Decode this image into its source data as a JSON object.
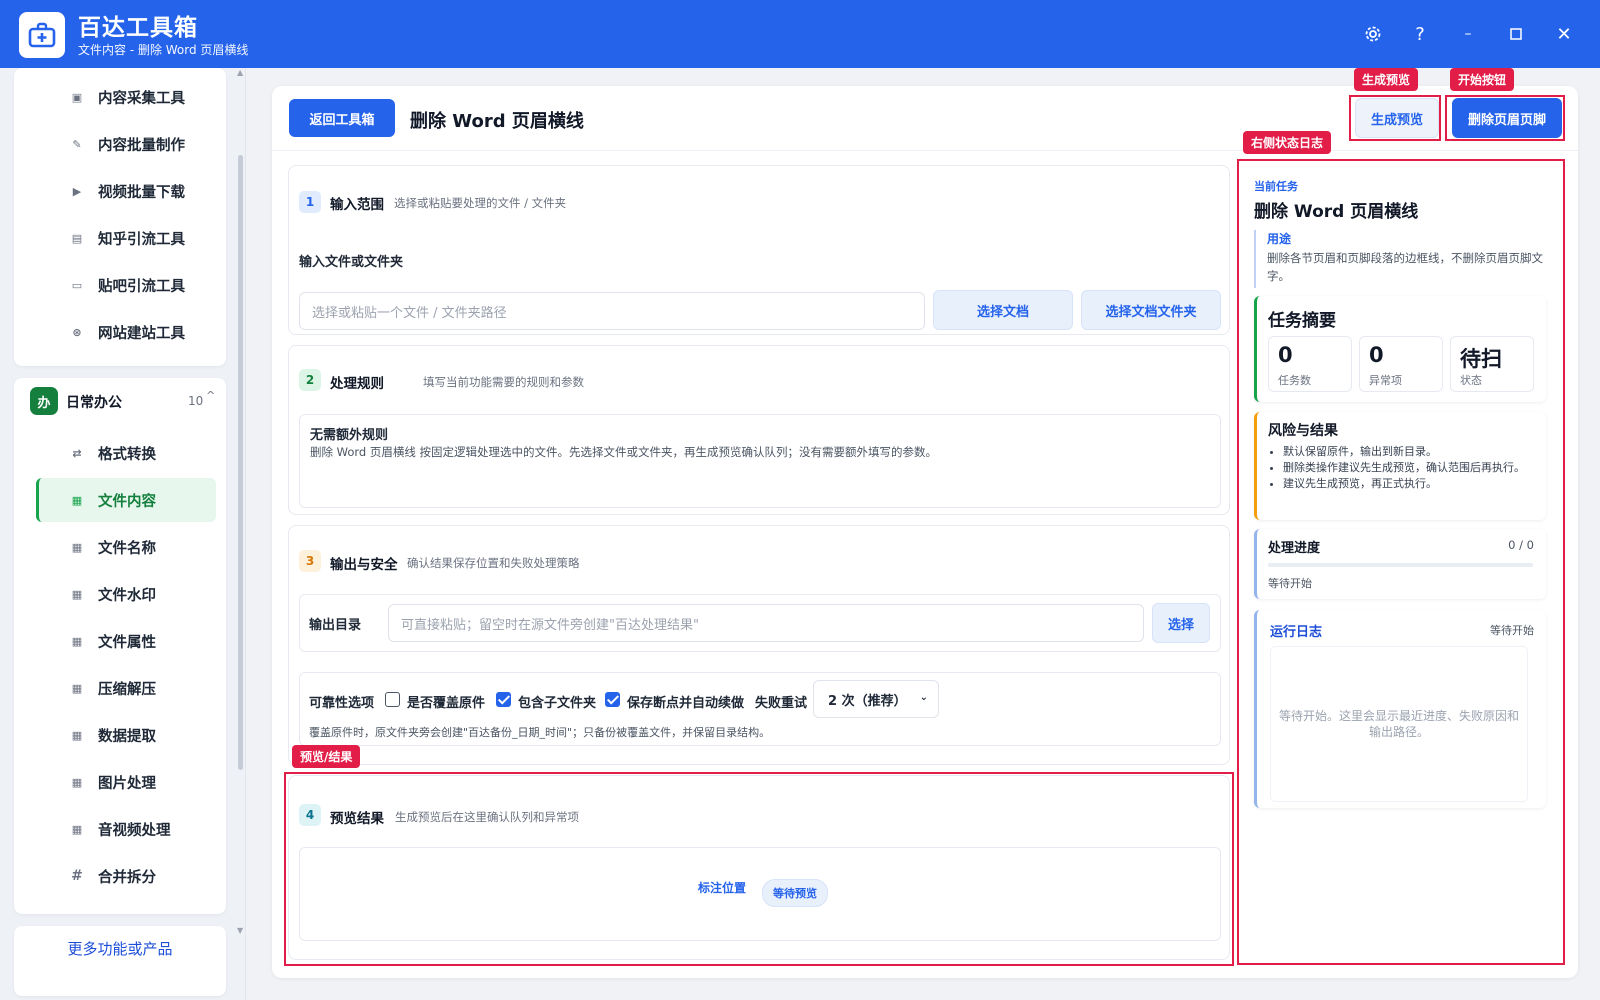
{
  "app": {
    "title": "百达工具箱",
    "subtitle": "文件内容 - 删除 Word 页眉横线",
    "icon": "toolbox-plus-icon"
  },
  "titlebar_buttons": [
    "settings-icon",
    "help-icon",
    "minimize-icon",
    "maximize-icon",
    "close-icon"
  ],
  "sidebar": {
    "group_top": {
      "items": [
        {
          "label": "内容采集工具",
          "icon": "collect-icon"
        },
        {
          "label": "内容批量制作",
          "icon": "edit-icon"
        },
        {
          "label": "视频批量下载",
          "icon": "video-icon"
        },
        {
          "label": "知乎引流工具",
          "icon": "zhihu-icon"
        },
        {
          "label": "贴吧引流工具",
          "icon": "tieba-icon"
        },
        {
          "label": "网站建站工具",
          "icon": "web-icon"
        }
      ]
    },
    "group_office": {
      "badge": "办",
      "title": "日常办公",
      "count": "10",
      "items": [
        {
          "label": "格式转换",
          "icon": "swap-icon"
        },
        {
          "label": "文件内容",
          "icon": "grid-icon",
          "active": true
        },
        {
          "label": "文件名称",
          "icon": "grid-icon"
        },
        {
          "label": "文件水印",
          "icon": "grid-icon"
        },
        {
          "label": "文件属性",
          "icon": "grid-icon"
        },
        {
          "label": "压缩解压",
          "icon": "grid-icon"
        },
        {
          "label": "数据提取",
          "icon": "grid-icon"
        },
        {
          "label": "图片处理",
          "icon": "grid-icon"
        },
        {
          "label": "音视频处理",
          "icon": "grid-icon"
        },
        {
          "label": "合并拆分",
          "icon": "hash-icon"
        }
      ]
    },
    "more_label": "更多功能或产品"
  },
  "header": {
    "back_label": "返回工具箱",
    "title": "删除 Word 页眉横线",
    "preview_label": "生成预览",
    "run_label": "删除页眉页脚"
  },
  "annotations": {
    "preview": "生成预览",
    "start": "开始按钮",
    "right_log": "右侧状态日志",
    "result": "预览/结果"
  },
  "section1": {
    "num": "1",
    "title": "输入范围",
    "desc": "选择或粘贴要处理的文件 / 文件夹",
    "field_label": "输入文件或文件夹",
    "placeholder": "选择或粘贴一个文件 / 文件夹路径",
    "btn_doc": "选择文档",
    "btn_folder": "选择文档文件夹"
  },
  "section2": {
    "num": "2",
    "title": "处理规则",
    "desc": "填写当前功能需要的规则和参数",
    "rule_title": "无需额外规则",
    "rule_text": "删除 Word 页眉横线 按固定逻辑处理选中的文件。先选择文件或文件夹，再生成预览确认队列；没有需要额外填写的参数。"
  },
  "section3": {
    "num": "3",
    "title": "输出与安全",
    "desc": "确认结果保存位置和失败处理策略",
    "out_label": "输出目录",
    "out_placeholder": "可直接粘贴；留空时在源文件旁创建\"百达处理结果\"",
    "out_btn": "选择",
    "rel_label": "可靠性选项",
    "opt_overwrite": "是否覆盖原件",
    "opt_overwrite_checked": false,
    "opt_sub": "包含子文件夹",
    "opt_sub_checked": true,
    "opt_resume": "保存断点并自动续做",
    "opt_resume_checked": true,
    "retry_label": "失败重试",
    "retry_value": "2 次（推荐）",
    "note": "覆盖原件时，原文件夹旁会创建\"百达备份_日期_时间\"；只备份被覆盖文件，并保留目录结构。"
  },
  "section4": {
    "num": "4",
    "title": "预览结果",
    "desc": "生成预览后在这里确认队列和异常项",
    "mark_label": "标注位置",
    "status_pill": "等待预览"
  },
  "right": {
    "current_label": "当前任务",
    "task_title": "删除 Word 页眉横线",
    "purpose_label": "用途",
    "purpose_text": "删除各节页眉和页脚段落的边框线，不删除页眉页脚文字。",
    "summary_title": "任务摘要",
    "stats": [
      {
        "value": "0",
        "label": "任务数"
      },
      {
        "value": "0",
        "label": "异常项"
      },
      {
        "value": "待扫",
        "label": "状态"
      }
    ],
    "risk_title": "风险与结果",
    "risks": [
      "默认保留原件，输出到新目录。",
      "删除类操作建议先生成预览，确认范围后再执行。",
      "建议先生成预览，再正式执行。"
    ],
    "progress_title": "处理进度",
    "progress_count": "0 / 0",
    "progress_fraction": 0,
    "progress_status": "等待开始",
    "log_title": "运行日志",
    "log_status": "等待开始",
    "log_text": "等待开始。这里会显示最近进度、失败原因和输出路径。"
  },
  "colors": {
    "brand": "#2563eb",
    "active_green": "#16a34a",
    "annotation_red": "#e11d48"
  }
}
